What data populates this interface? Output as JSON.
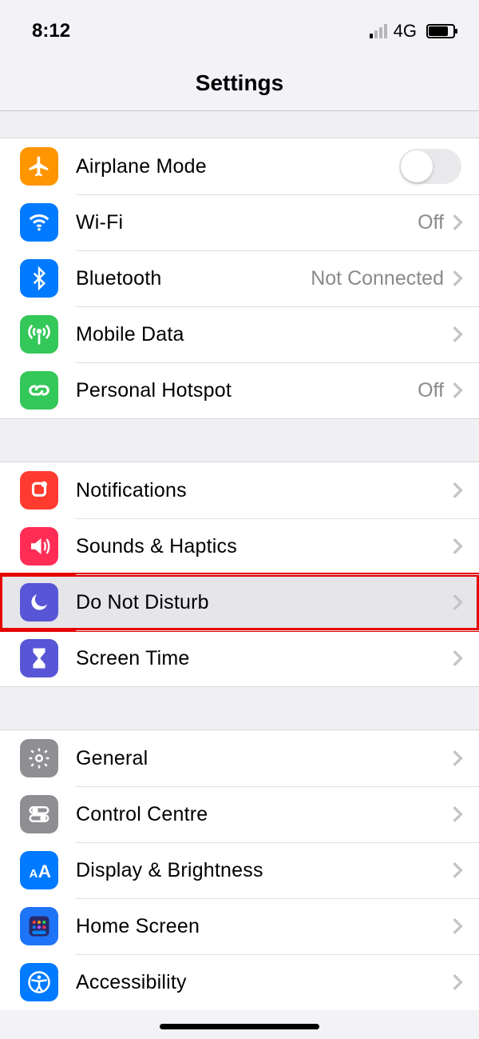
{
  "status": {
    "time": "8:12",
    "network": "4G"
  },
  "header": {
    "title": "Settings"
  },
  "groups": [
    {
      "rows": [
        {
          "id": "airplane",
          "label": "Airplane Mode",
          "value": "",
          "icon": "airplane-icon",
          "color": "bg-orange",
          "type": "toggle",
          "toggle": false
        },
        {
          "id": "wifi",
          "label": "Wi-Fi",
          "value": "Off",
          "icon": "wifi-icon",
          "color": "bg-blue",
          "type": "drill"
        },
        {
          "id": "bluetooth",
          "label": "Bluetooth",
          "value": "Not Connected",
          "icon": "bluetooth-icon",
          "color": "bg-blue",
          "type": "drill"
        },
        {
          "id": "mobile",
          "label": "Mobile Data",
          "value": "",
          "icon": "antenna-icon",
          "color": "bg-green",
          "type": "drill"
        },
        {
          "id": "hotspot",
          "label": "Personal Hotspot",
          "value": "Off",
          "icon": "link-icon",
          "color": "bg-green",
          "type": "drill"
        }
      ]
    },
    {
      "rows": [
        {
          "id": "notifications",
          "label": "Notifications",
          "value": "",
          "icon": "bell-icon",
          "color": "bg-red",
          "type": "drill"
        },
        {
          "id": "sounds",
          "label": "Sounds & Haptics",
          "value": "",
          "icon": "speaker-icon",
          "color": "bg-pink",
          "type": "drill"
        },
        {
          "id": "dnd",
          "label": "Do Not Disturb",
          "value": "",
          "icon": "moon-icon",
          "color": "bg-purple",
          "type": "drill",
          "highlight": true
        },
        {
          "id": "screentime",
          "label": "Screen Time",
          "value": "",
          "icon": "hourglass-icon",
          "color": "bg-purple",
          "type": "drill"
        }
      ]
    },
    {
      "rows": [
        {
          "id": "general",
          "label": "General",
          "value": "",
          "icon": "gear-icon",
          "color": "bg-gray",
          "type": "drill"
        },
        {
          "id": "controlcentre",
          "label": "Control Centre",
          "value": "",
          "icon": "switches-icon",
          "color": "bg-gray",
          "type": "drill"
        },
        {
          "id": "display",
          "label": "Display & Brightness",
          "value": "",
          "icon": "textsize-icon",
          "color": "bg-blue",
          "type": "drill"
        },
        {
          "id": "homescreen",
          "label": "Home Screen",
          "value": "",
          "icon": "grid-icon",
          "color": "bg-multicolor",
          "type": "drill"
        },
        {
          "id": "accessibility",
          "label": "Accessibility",
          "value": "",
          "icon": "accessibility-icon",
          "color": "bg-blue",
          "type": "drill"
        }
      ]
    }
  ]
}
